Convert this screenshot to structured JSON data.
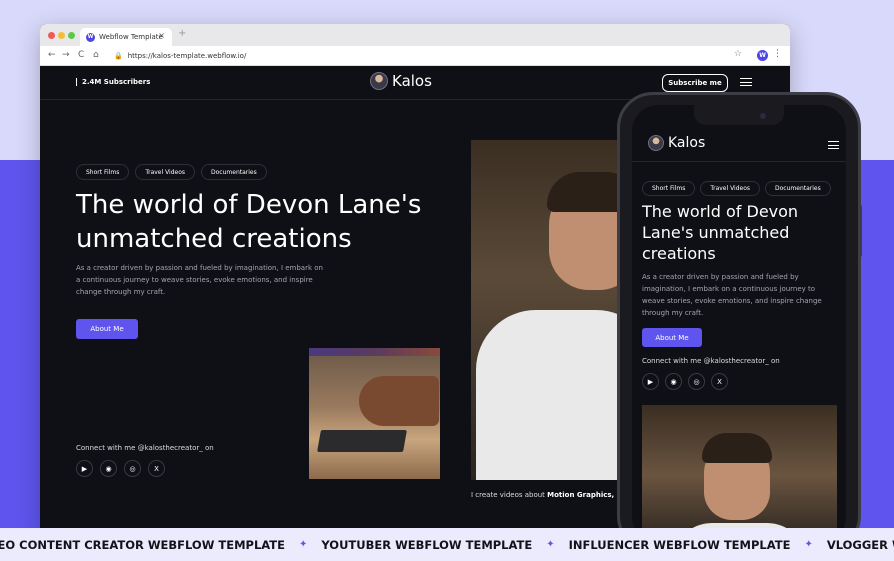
{
  "browser": {
    "tab_title": "Webflow Template",
    "tab_favicon": "W",
    "tab_close": "×",
    "new_tab": "+",
    "back": "←",
    "forward": "→",
    "reload": "C",
    "home": "⌂",
    "url": "https://kalos-template.webflow.io/",
    "star": "☆",
    "profile": "W",
    "menu": "⋮"
  },
  "header": {
    "subscribers": "2.4M Subscribers",
    "logo_text": "Kalos",
    "subscribe_label": "Subscribe me"
  },
  "hero": {
    "pills": [
      "Short Films",
      "Travel Videos",
      "Documentaries"
    ],
    "title": "The world of Devon Lane's unmatched creations",
    "description": "As a creator driven by passion and fueled by imagination, I embark on a continuous journey to weave stories, evoke emotions, and inspire change through my craft.",
    "about_label": "About Me",
    "connect": "Connect with me @kalosthecreator_ on",
    "caption_prefix": "I create videos about ",
    "caption_bold": "Motion Graphics, Docu"
  },
  "socials": [
    {
      "icon": "youtube-icon",
      "glyph": "▶"
    },
    {
      "icon": "discord-icon",
      "glyph": "◉"
    },
    {
      "icon": "instagram-icon",
      "glyph": "◎"
    },
    {
      "icon": "x-icon",
      "glyph": "X"
    }
  ],
  "phone": {
    "logo_text": "Kalos",
    "pills": [
      "Short Films",
      "Travel Videos",
      "Documentaries"
    ],
    "title": "The world of Devon Lane's unmatched creations",
    "description": "As a creator driven by passion and fueled by imagination, I embark on a continuous journey to weave stories, evoke emotions, and inspire change through my craft.",
    "about_label": "About Me",
    "connect": "Connect with me @kalosthecreator_ on"
  },
  "marquee": {
    "items": [
      "DEO CONTENT CREATOR WEBFLOW TEMPLATE",
      "YOUTUBER WEBFLOW TEMPLATE",
      "INFLUENCER WEBFLOW TEMPLATE",
      "VLOGGER WEBFLOW TEMPLA"
    ],
    "separator": "✦"
  },
  "colors": {
    "accent": "#5f55ee",
    "background_light": "#d9d9fb",
    "site_dark": "#0f0f16"
  }
}
